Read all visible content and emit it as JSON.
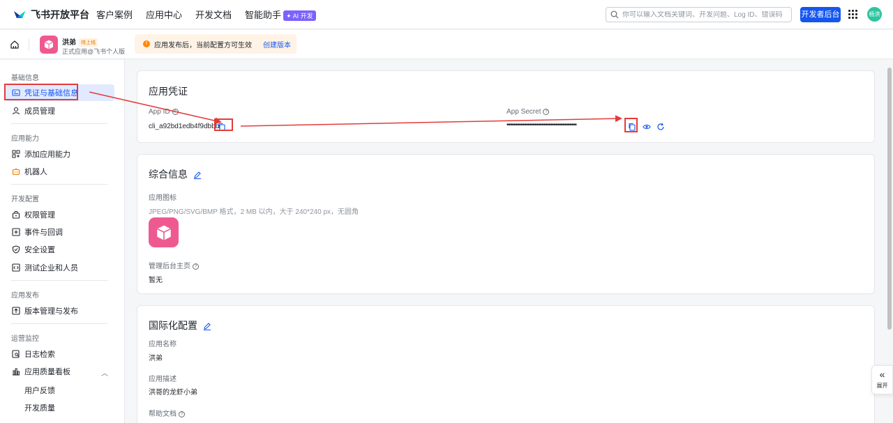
{
  "topbar": {
    "logo_text": "飞书开放平台",
    "nav": [
      "客户案例",
      "应用中心",
      "开发文档",
      "智能助手"
    ],
    "ai_badge": "✦ AI 开发",
    "search_placeholder": "你可以输入文档关键词、开发问题、Log ID、错误码",
    "dev_console": "开发者后台",
    "avatar_text": "杨洪"
  },
  "app": {
    "name": "洪弟",
    "status": "待上线",
    "subtitle": "正式应用@飞书个人版",
    "icon_color": "#ee5a8f"
  },
  "notice": {
    "text": "应用发布后，当前配置方可生效",
    "link": "创建版本"
  },
  "sidebar": {
    "sections": [
      {
        "title": "基础信息",
        "items": [
          "凭证与基础信息",
          "成员管理"
        ]
      },
      {
        "title": "应用能力",
        "items": [
          "添加应用能力",
          "机器人"
        ]
      },
      {
        "title": "开发配置",
        "items": [
          "权限管理",
          "事件与回调",
          "安全设置",
          "测试企业和人员"
        ]
      },
      {
        "title": "应用发布",
        "items": [
          "版本管理与发布"
        ]
      },
      {
        "title": "运营监控",
        "items": [
          "日志检索",
          "应用质量看板"
        ],
        "subitems": [
          "用户反馈",
          "开发质量"
        ]
      }
    ],
    "active_color": "#1456f0"
  },
  "credentials": {
    "title": "应用凭证",
    "app_id_label": "App ID",
    "app_id_value": "cli_a92bd1edb4f9dbbb",
    "app_secret_label": "App Secret",
    "app_secret_value": "••••••••••••••••••••••••••••••••••••••••"
  },
  "general": {
    "title": "综合信息",
    "icon_label": "应用图标",
    "icon_hint": "JPEG/PNG/SVG/BMP 格式，2 MB 以内，大于 240*240 px，无圆角",
    "homepage_label": "管理后台主页",
    "homepage_value": "暂无"
  },
  "i18n": {
    "title": "国际化配置",
    "name_label": "应用名称",
    "name_value": "洪弟",
    "desc_label": "应用描述",
    "desc_value": "洪哥的龙虾小弟",
    "help_label": "帮助文档"
  },
  "expand": {
    "arrow": "«",
    "label": "展开"
  }
}
